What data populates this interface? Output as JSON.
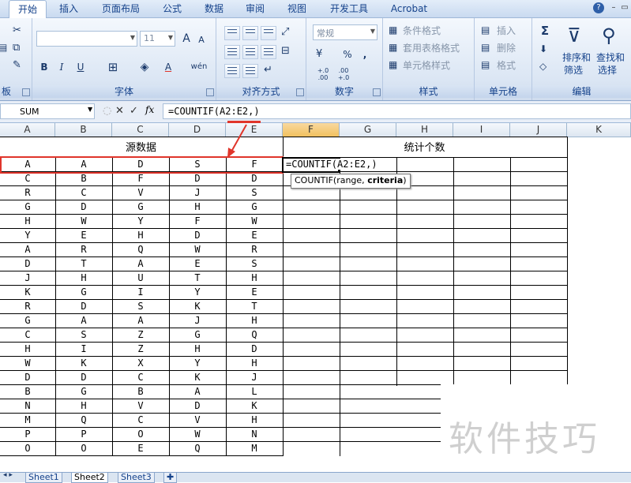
{
  "ribbon_tabs": [
    "开始",
    "插入",
    "页面布局",
    "公式",
    "数据",
    "审阅",
    "视图",
    "开发工具",
    "Acrobat"
  ],
  "help": "?",
  "groups": {
    "clipboard": "板",
    "font": "字体",
    "alignment": "对齐方式",
    "number": "数字",
    "styles": "样式",
    "cells": "单元格",
    "editing": "编辑"
  },
  "font": {
    "size": "11",
    "bold": "B",
    "italic": "I",
    "underline": "U",
    "grow": "A",
    "shrink": "A",
    "color_a": "A",
    "wen": "wén"
  },
  "number": {
    "format": "常规",
    "percent": "%",
    "comma": ",",
    "inc": "+.0 .00",
    "dec": ".00 +.0"
  },
  "styles": {
    "conditional": "条件格式",
    "table": "套用表格格式",
    "cell": "单元格样式"
  },
  "cells": {
    "insert": "插入",
    "delete": "删除",
    "format": "格式"
  },
  "editing": {
    "sum": "Σ",
    "sort": "排序和\n筛选",
    "sort1": "排序和",
    "sort2": "筛选",
    "find1": "查找和",
    "find2": "选择"
  },
  "namebox": "SUM",
  "formula_buttons": {
    "cancel": "✕",
    "enter": "✓",
    "fx": "fx"
  },
  "formula": "=COUNTIF(A2:E2,)",
  "columns": [
    "A",
    "B",
    "C",
    "D",
    "E",
    "F",
    "G",
    "H",
    "I",
    "J",
    "K"
  ],
  "titles": {
    "source": "源数据",
    "count": "统计个数"
  },
  "rows": [
    [
      "A",
      "A",
      "D",
      "S",
      "F"
    ],
    [
      "C",
      "B",
      "F",
      "D",
      "D"
    ],
    [
      "R",
      "C",
      "V",
      "J",
      "S"
    ],
    [
      "G",
      "D",
      "G",
      "H",
      "G"
    ],
    [
      "H",
      "W",
      "Y",
      "F",
      "W"
    ],
    [
      "Y",
      "E",
      "H",
      "D",
      "E"
    ],
    [
      "A",
      "R",
      "Q",
      "W",
      "R"
    ],
    [
      "D",
      "T",
      "A",
      "E",
      "S"
    ],
    [
      "J",
      "H",
      "U",
      "T",
      "H"
    ],
    [
      "K",
      "G",
      "I",
      "Y",
      "E"
    ],
    [
      "R",
      "D",
      "S",
      "K",
      "T"
    ],
    [
      "G",
      "A",
      "A",
      "J",
      "H"
    ],
    [
      "C",
      "S",
      "Z",
      "G",
      "Q"
    ],
    [
      "H",
      "I",
      "Z",
      "H",
      "D"
    ],
    [
      "W",
      "K",
      "X",
      "Y",
      "H"
    ],
    [
      "D",
      "D",
      "C",
      "K",
      "J"
    ],
    [
      "B",
      "G",
      "B",
      "A",
      "L"
    ],
    [
      "N",
      "H",
      "V",
      "D",
      "K"
    ],
    [
      "M",
      "Q",
      "C",
      "V",
      "H"
    ],
    [
      "P",
      "P",
      "O",
      "W",
      "N"
    ],
    [
      "O",
      "O",
      "E",
      "Q",
      "M"
    ]
  ],
  "editing_cell": "=COUNTIF(A2:E2,)",
  "tooltip": {
    "prefix": "COUNTIF(range, ",
    "bold": "criteria",
    "suffix": ")"
  },
  "watermark": "软件技巧",
  "sheets": [
    "Sheet1",
    "Sheet2",
    "Sheet3"
  ],
  "colors": {
    "highlight_red": "#e0352b",
    "ribbon_text": "#15428b"
  }
}
